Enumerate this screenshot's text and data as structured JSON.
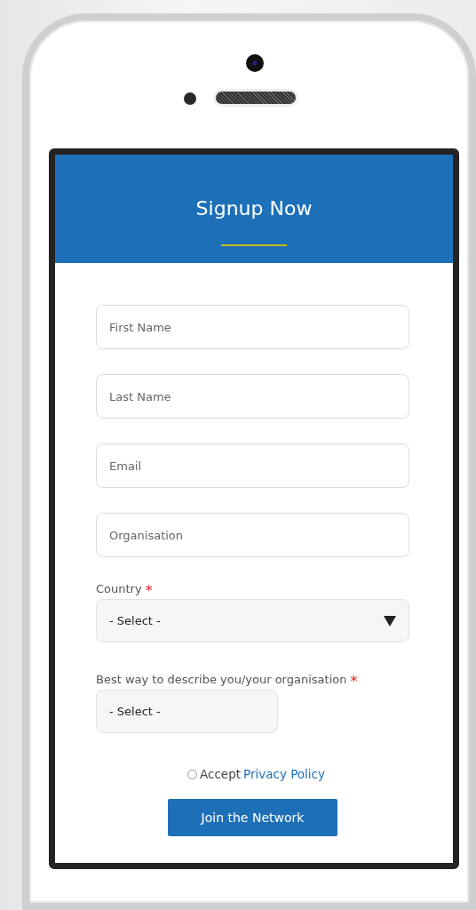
{
  "header": {
    "title": "Signup Now"
  },
  "fields": [
    {
      "placeholder": "First Name"
    },
    {
      "placeholder": "Last Name"
    },
    {
      "placeholder": "Email"
    },
    {
      "placeholder": "Organisation"
    }
  ],
  "selects": [
    {
      "label": "Country",
      "required_mark": "*",
      "value": "- Select -",
      "wide": true,
      "arrow": true
    },
    {
      "label": "Best way to describe you/your organisation",
      "required_mark": "*",
      "value": "- Select -",
      "wide": false,
      "arrow": false
    }
  ],
  "consent": {
    "checked": false,
    "text": "Accept",
    "link": "Privacy Policy"
  },
  "submit": {
    "label": "Join the Network"
  }
}
